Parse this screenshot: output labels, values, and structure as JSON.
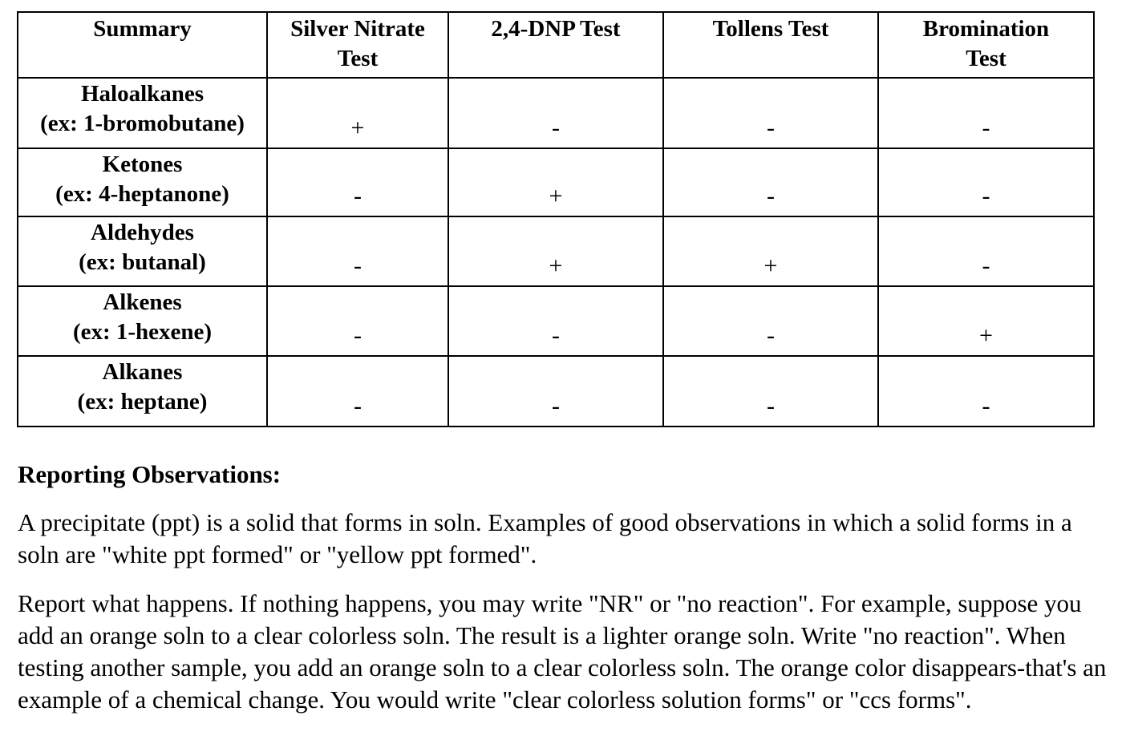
{
  "table": {
    "headers": [
      "Summary",
      "Silver Nitrate Test",
      "2,4-DNP Test",
      "Tollens Test",
      "Bromination Test"
    ],
    "header_lines": [
      [
        "Summary"
      ],
      [
        "Silver Nitrate",
        "Test"
      ],
      [
        "2,4-DNP Test"
      ],
      [
        "Tollens Test"
      ],
      [
        "Bromination",
        "Test"
      ]
    ],
    "rows": [
      {
        "class_name": "Haloalkanes",
        "example": "(ex: 1-bromobutane)",
        "results": [
          "+",
          "-",
          "-",
          "-"
        ]
      },
      {
        "class_name": "Ketones",
        "example": "(ex: 4-heptanone)",
        "results": [
          "-",
          "+",
          "-",
          "-"
        ]
      },
      {
        "class_name": "Aldehydes",
        "example": "(ex: butanal)",
        "results": [
          "-",
          "+",
          "+",
          "-"
        ]
      },
      {
        "class_name": "Alkenes",
        "example": "(ex: 1-hexene)",
        "results": [
          "-",
          "-",
          "-",
          "+"
        ]
      },
      {
        "class_name": "Alkanes",
        "example": "(ex: heptane)",
        "results": [
          "-",
          "-",
          "-",
          "-"
        ]
      }
    ]
  },
  "section": {
    "heading": "Reporting Observations:",
    "paragraphs": [
      "A precipitate (ppt) is a solid that forms in soln. Examples of good observations in which a solid forms in a soln are \"white ppt formed\" or \"yellow ppt formed\".",
      "Report what happens. If nothing happens, you may write \"NR\" or \"no reaction\". For example, suppose you add an orange soln to a clear colorless soln. The result is a lighter orange soln. Write \"no reaction\". When testing another sample, you add an orange soln to a clear colorless soln. The orange color disappears-that's an example of a chemical change. You would write \"clear colorless solution forms\" or \"ccs forms\"."
    ]
  }
}
